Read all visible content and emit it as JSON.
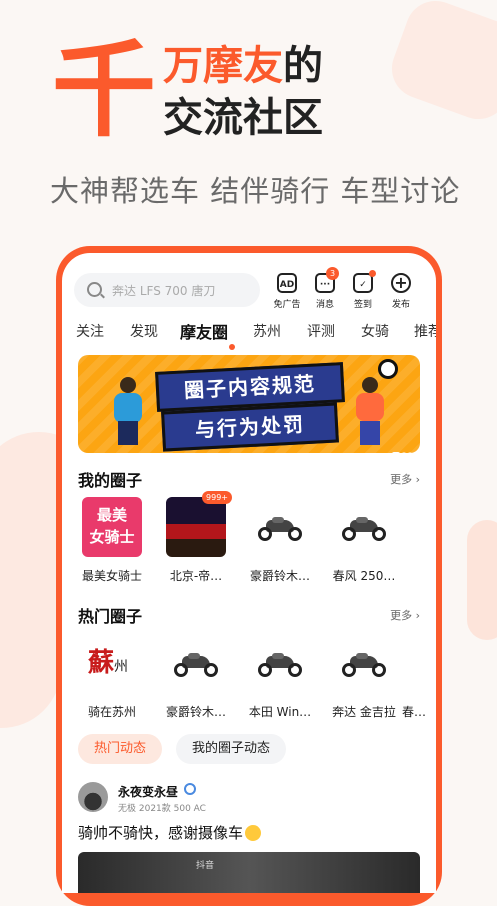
{
  "promo": {
    "big_char": "千",
    "headline_hl": "万摩友",
    "headline_rest": "的",
    "headline_line2": "交流社区",
    "subline": "大神帮选车  结伴骑行  车型讨论"
  },
  "search": {
    "placeholder": "奔达 LFS 700 唐刀"
  },
  "top_icons": [
    {
      "label": "免广告",
      "glyph": "AD"
    },
    {
      "label": "消息",
      "glyph": "···",
      "badge": "3"
    },
    {
      "label": "签到",
      "glyph": "✓"
    },
    {
      "label": "发布",
      "glyph": "+"
    }
  ],
  "tabs": [
    "关注",
    "发现",
    "摩友圈",
    "苏州",
    "评测",
    "女骑",
    "推荐"
  ],
  "active_tab": "摩友圈",
  "banner": {
    "line1": "圈子内容规范",
    "line2": "与行为处罚"
  },
  "my_circles": {
    "title": "我的圈子",
    "more": "更多 ›",
    "thumb_text": "最美\n女骑士",
    "thumb_badge": "999+",
    "items": [
      {
        "name": "最美女骑士"
      },
      {
        "name": "北京-帝…"
      },
      {
        "name": "豪爵铃木…"
      },
      {
        "name": "春风 250…"
      }
    ]
  },
  "hot_circles": {
    "title": "热门圈子",
    "more": "更多 ›",
    "su_text": "蘇",
    "zhou_text": "州",
    "items": [
      {
        "name": "骑在苏州"
      },
      {
        "name": "豪爵铃木…"
      },
      {
        "name": "本田 Win…"
      },
      {
        "name": "奔达 金吉拉"
      },
      {
        "name": "春…"
      }
    ]
  },
  "feed_tabs": {
    "active": "热门动态",
    "other": "我的圈子动态"
  },
  "post": {
    "user": "永夜变永昼",
    "sub": "无极 2021款 500 AC",
    "text": "骑帅不骑快，感谢摄像车",
    "watermark": "抖音"
  },
  "colors": {
    "accent": "#fb5a2c",
    "banner": "#fca512"
  }
}
